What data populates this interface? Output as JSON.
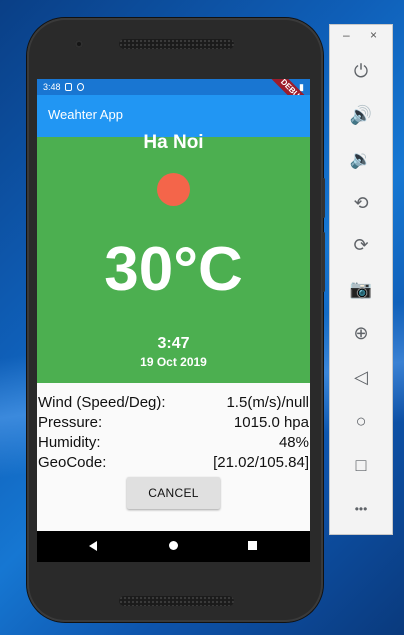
{
  "status_bar": {
    "time": "3:48",
    "debug_label": "DEBUG"
  },
  "app_bar": {
    "title": "Weahter App"
  },
  "weather": {
    "city": "Ha Noi",
    "temperature": "30°C",
    "time": "3:47",
    "date": "19 Oct 2019"
  },
  "info": [
    {
      "label": "Wind (Speed/Deg):",
      "value": "1.5(m/s)/null"
    },
    {
      "label": "Pressure:",
      "value": "1015.0 hpa"
    },
    {
      "label": "Humidity:",
      "value": "48%"
    },
    {
      "label": "GeoCode:",
      "value": "[21.02/105.84]"
    }
  ],
  "buttons": {
    "cancel": "CANCEL"
  },
  "emulator": {
    "minimize": "–",
    "close": "×",
    "controls": [
      {
        "name": "power-icon",
        "glyph": "⏻"
      },
      {
        "name": "volume-up-icon",
        "glyph": "🔊"
      },
      {
        "name": "volume-down-icon",
        "glyph": "🔉"
      },
      {
        "name": "rotate-left-icon",
        "glyph": "⟲"
      },
      {
        "name": "rotate-right-icon",
        "glyph": "⟳"
      },
      {
        "name": "camera-icon",
        "glyph": "📷"
      },
      {
        "name": "zoom-icon",
        "glyph": "⊕"
      },
      {
        "name": "back-icon",
        "glyph": "◁"
      },
      {
        "name": "home-icon",
        "glyph": "○"
      },
      {
        "name": "overview-icon",
        "glyph": "□"
      },
      {
        "name": "more-icon",
        "glyph": "•••"
      }
    ]
  },
  "colors": {
    "app_bar": "#2196f3",
    "status_bar": "#1976d2",
    "weather_panel": "#4caf50",
    "sun": "#f4654a"
  }
}
